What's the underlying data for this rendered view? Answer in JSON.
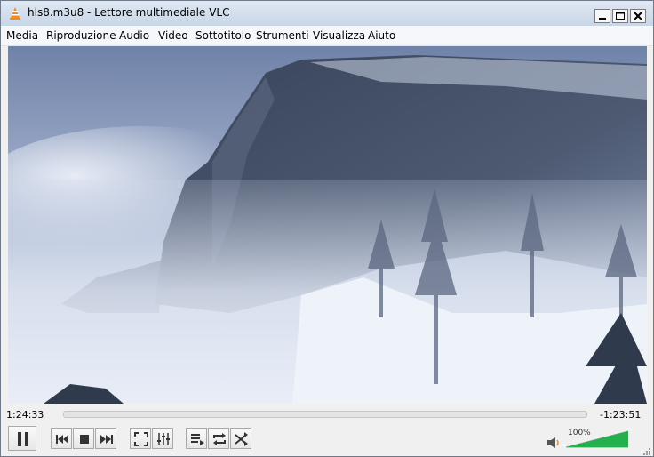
{
  "window": {
    "title": "hls8.m3u8 - Lettore multimediale VLC"
  },
  "menubar": {
    "items": [
      "Media",
      "Riproduzione",
      "Audio",
      "Video",
      "Sottotitolo",
      "Strumenti",
      "Visualizza",
      "Aiuto"
    ]
  },
  "player": {
    "elapsed": "1:24:33",
    "remaining": "-1:23:51",
    "volume_label": "100%",
    "volume_level": 1.0,
    "seek_progress": 0.0
  },
  "icons": [
    "vlc-cone-icon",
    "minimize-icon",
    "maximize-icon",
    "close-icon",
    "pause-icon",
    "previous-icon",
    "stop-icon",
    "next-icon",
    "fullscreen-icon",
    "extended-settings-icon",
    "playlist-icon",
    "loop-icon",
    "shuffle-icon",
    "speaker-icon"
  ],
  "colors": {
    "titlebar": "#c9d6e6",
    "volume_fill": "#22b14c",
    "vlc_orange": "#f48a1c"
  }
}
